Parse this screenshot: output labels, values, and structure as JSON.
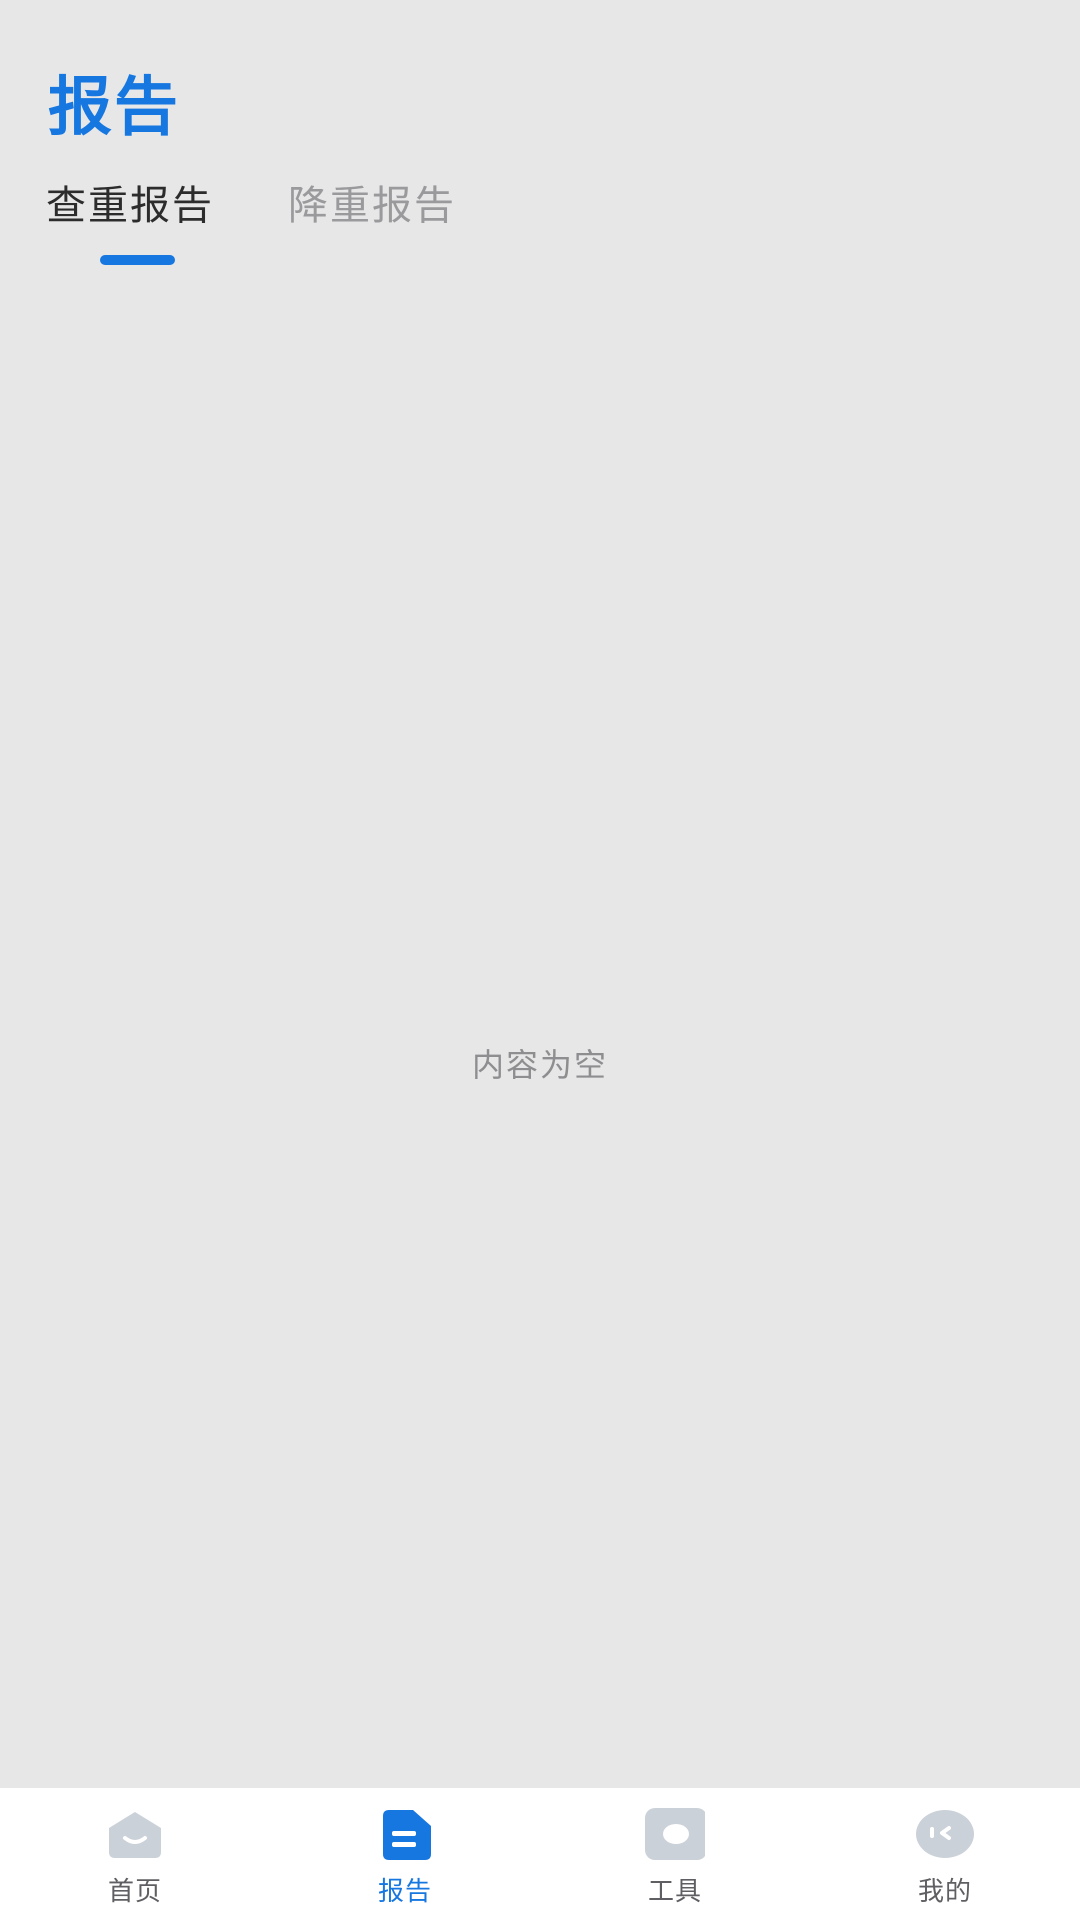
{
  "header": {
    "title": "报告"
  },
  "tabs": [
    {
      "label": "查重报告",
      "active": true
    },
    {
      "label": "降重报告",
      "active": false
    }
  ],
  "content": {
    "empty_text": "内容为空"
  },
  "bottom_nav": {
    "items": [
      {
        "label": "首页",
        "icon": "home-icon",
        "active": false
      },
      {
        "label": "报告",
        "icon": "report-icon",
        "active": true
      },
      {
        "label": "工具",
        "icon": "tools-icon",
        "active": false
      },
      {
        "label": "我的",
        "icon": "profile-icon",
        "active": false
      }
    ]
  },
  "colors": {
    "accent": "#1677e0",
    "background": "#e7e7e8",
    "inactive_icon": "#cbd1d9",
    "inactive_text": "#9a9a9d"
  }
}
